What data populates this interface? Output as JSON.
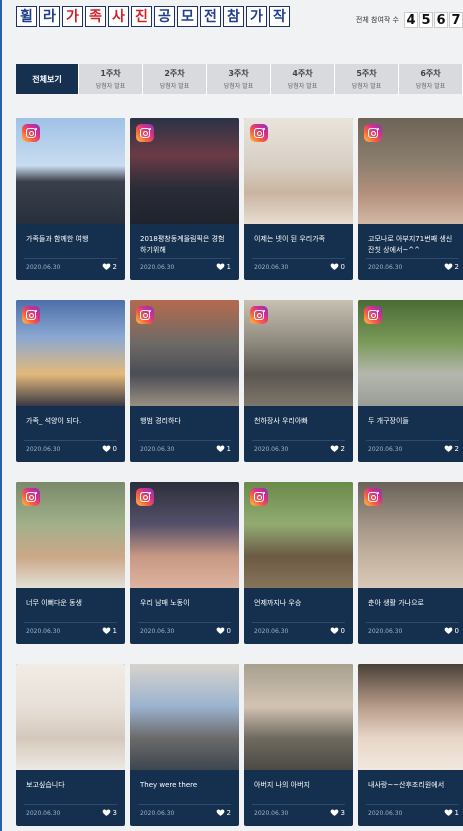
{
  "header": {
    "title_chars": [
      {
        "ch": "휠",
        "color": "#1d3f8c"
      },
      {
        "ch": "라",
        "color": "#1d3f8c"
      },
      {
        "ch": "가",
        "color": "#d51f27"
      },
      {
        "ch": "족",
        "color": "#d51f27"
      },
      {
        "ch": "사",
        "color": "#d51f27"
      },
      {
        "ch": "진",
        "color": "#d51f27"
      },
      {
        "ch": "공",
        "color": "#1d3f8c"
      },
      {
        "ch": "모",
        "color": "#1d3f8c"
      },
      {
        "ch": "전",
        "color": "#1d3f8c"
      },
      {
        "ch": "참",
        "color": "#1d3f8c"
      },
      {
        "ch": "가",
        "color": "#1d3f8c"
      },
      {
        "ch": "작",
        "color": "#1d3f8c"
      }
    ],
    "entries_label": "전체 참여작 수",
    "entries_digits": [
      "4",
      "5",
      "6",
      "7"
    ]
  },
  "tabs": [
    {
      "label": "전체보기",
      "sub": ""
    },
    {
      "label": "1주차",
      "sub": "당첨자 발표"
    },
    {
      "label": "2주차",
      "sub": "당첨자 발표"
    },
    {
      "label": "3주차",
      "sub": "당첨자 발표"
    },
    {
      "label": "4주차",
      "sub": "당첨자 발표"
    },
    {
      "label": "5주차",
      "sub": "당첨자 발표"
    },
    {
      "label": "6주차",
      "sub": "당첨자 발표"
    }
  ],
  "cards": [
    {
      "caption": "가족들과 함께한 여행",
      "date": "2020.06.30",
      "likes": "2"
    },
    {
      "caption": "2018평창동계올림픽은 경험 하기위해",
      "date": "2020.06.30",
      "likes": "1"
    },
    {
      "caption": "이제는 넷이 된 우리가족",
      "date": "2020.06.30",
      "likes": "0"
    },
    {
      "caption": "고모나로 아부지71번째 생신 잔칫 상에서~^^",
      "date": "2020.06.30",
      "likes": "2"
    },
    {
      "caption": "가족_ 석양이 되다.",
      "date": "2020.06.30",
      "likes": "0"
    },
    {
      "caption": "행범 경리하다",
      "date": "2020.06.30",
      "likes": "1"
    },
    {
      "caption": "천하장사 우리아빠",
      "date": "2020.06.30",
      "likes": "2"
    },
    {
      "caption": "두 개구장이들",
      "date": "2020.06.30",
      "likes": "2"
    },
    {
      "caption": "너무 이뻐다운 동생",
      "date": "2020.06.30",
      "likes": "1"
    },
    {
      "caption": "우리 남매 노동이",
      "date": "2020.06.30",
      "likes": "0"
    },
    {
      "caption": "언제까지나 우승",
      "date": "2020.06.30",
      "likes": "0"
    },
    {
      "caption": "춘아 생활 가나으로",
      "date": "2020.06.30",
      "likes": "0"
    },
    {
      "caption": "보고싶습니다",
      "date": "2020.06.30",
      "likes": "3"
    },
    {
      "caption": "They were there",
      "date": "2020.06.30",
      "likes": "2"
    },
    {
      "caption": "아버지 나의 아버지",
      "date": "2020.06.30",
      "likes": "3"
    },
    {
      "caption": "내사랑~~산후조리원에서",
      "date": "2020.06.30",
      "likes": "1"
    }
  ]
}
